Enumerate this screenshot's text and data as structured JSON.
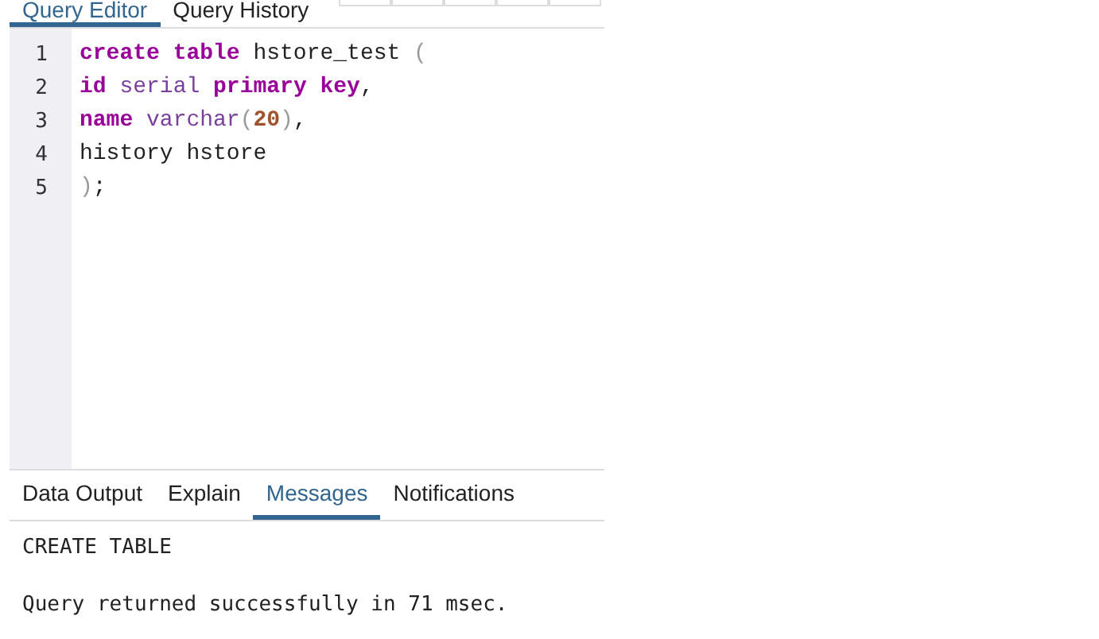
{
  "editor_tabs": [
    {
      "label": "Query Editor",
      "selected": true
    },
    {
      "label": "Query History",
      "selected": false
    }
  ],
  "code_lines": [
    {
      "number": "1",
      "tokens": [
        {
          "kind": "keyword",
          "text": "create "
        },
        {
          "kind": "keyword",
          "text": "table"
        },
        {
          "kind": "plain",
          "text": " hstore_test "
        },
        {
          "kind": "bracket",
          "text": "("
        }
      ]
    },
    {
      "number": "2",
      "tokens": [
        {
          "kind": "keyword",
          "text": "id "
        },
        {
          "kind": "type",
          "text": "serial "
        },
        {
          "kind": "keyword",
          "text": "primary "
        },
        {
          "kind": "keyword",
          "text": "key"
        },
        {
          "kind": "plain",
          "text": ","
        }
      ]
    },
    {
      "number": "3",
      "tokens": [
        {
          "kind": "keyword",
          "text": "name "
        },
        {
          "kind": "type",
          "text": "varchar"
        },
        {
          "kind": "bracket",
          "text": "("
        },
        {
          "kind": "number",
          "text": "20"
        },
        {
          "kind": "bracket",
          "text": ")"
        },
        {
          "kind": "plain",
          "text": ","
        }
      ]
    },
    {
      "number": "4",
      "tokens": [
        {
          "kind": "plain",
          "text": "history hstore"
        }
      ]
    },
    {
      "number": "5",
      "tokens": [
        {
          "kind": "bracket",
          "text": ")"
        },
        {
          "kind": "plain",
          "text": ";"
        }
      ]
    }
  ],
  "output_tabs": [
    {
      "label": "Data Output",
      "selected": false
    },
    {
      "label": "Explain",
      "selected": false
    },
    {
      "label": "Messages",
      "selected": true
    },
    {
      "label": "Notifications",
      "selected": false
    }
  ],
  "messages": [
    "CREATE TABLE",
    "Query returned successfully in 71 msec."
  ]
}
